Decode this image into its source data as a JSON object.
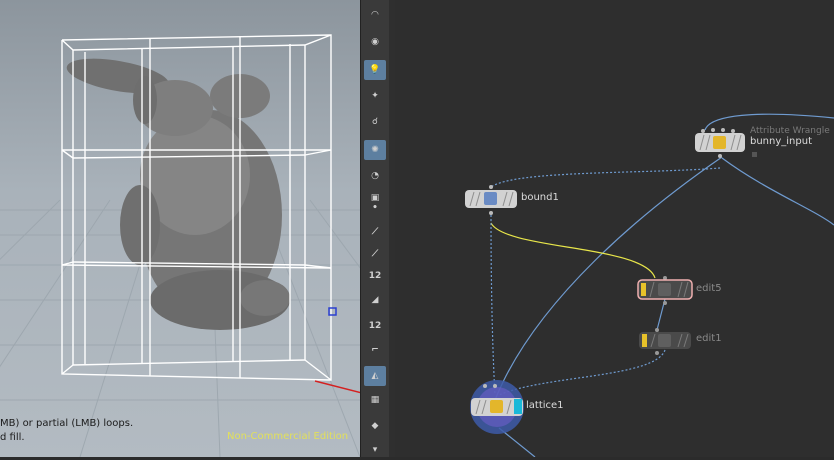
{
  "viewport": {
    "hint_line1": "MB) or partial (LMB) loops.",
    "hint_line2": "d fill.",
    "watermark": "Non-Commercial Edition"
  },
  "toolbar": {
    "items": [
      {
        "name": "lookthrough-icon",
        "active": false
      },
      {
        "name": "camera-icon",
        "active": false
      },
      {
        "name": "light-bulb-icon",
        "active": true
      },
      {
        "name": "point-light-icon",
        "active": false
      },
      {
        "name": "light-link-icon",
        "active": false
      },
      {
        "name": "ambient-occlusion-icon",
        "active": true
      },
      {
        "name": "visibility-eye-icon",
        "active": false
      },
      {
        "name": "display-options-icon",
        "active": false
      },
      {
        "name": "point-display-icon",
        "active": false
      },
      {
        "name": "normal-display-icon",
        "active": false
      },
      {
        "name": "vertex-normal-icon",
        "active": false
      },
      {
        "name": "point-numbers-icon",
        "active": false,
        "label": "12"
      },
      {
        "name": "primitive-display-icon",
        "active": false
      },
      {
        "name": "primitive-numbers-icon",
        "active": false,
        "label": "12"
      },
      {
        "name": "guide-display-icon",
        "active": false
      },
      {
        "name": "shaded-display-icon",
        "active": true
      },
      {
        "name": "texture-display-icon",
        "active": false
      },
      {
        "name": "background-icon",
        "active": false
      },
      {
        "name": "more-arrow-icon",
        "active": false
      }
    ]
  },
  "network": {
    "nodes": [
      {
        "id": "bunny_input",
        "label": "bunny_input",
        "sublabel": "Attribute Wrangle",
        "bypassed": false
      },
      {
        "id": "bound1",
        "label": "bound1",
        "bypassed": false
      },
      {
        "id": "edit5",
        "label": "edit5",
        "bypassed": true
      },
      {
        "id": "edit1",
        "label": "edit1",
        "bypassed": true
      },
      {
        "id": "lattice1",
        "label": "lattice1",
        "bypassed": false
      }
    ]
  },
  "colors": {
    "wire": "#6f9bd0",
    "selected_wire": "#e8e64a",
    "lattice_box": "#ffffff",
    "network_bg": "#2e2e2e",
    "node_body": "#d2d2d2",
    "display_flag": "#19b8d8",
    "bypass_flag": "#e8c22a"
  }
}
